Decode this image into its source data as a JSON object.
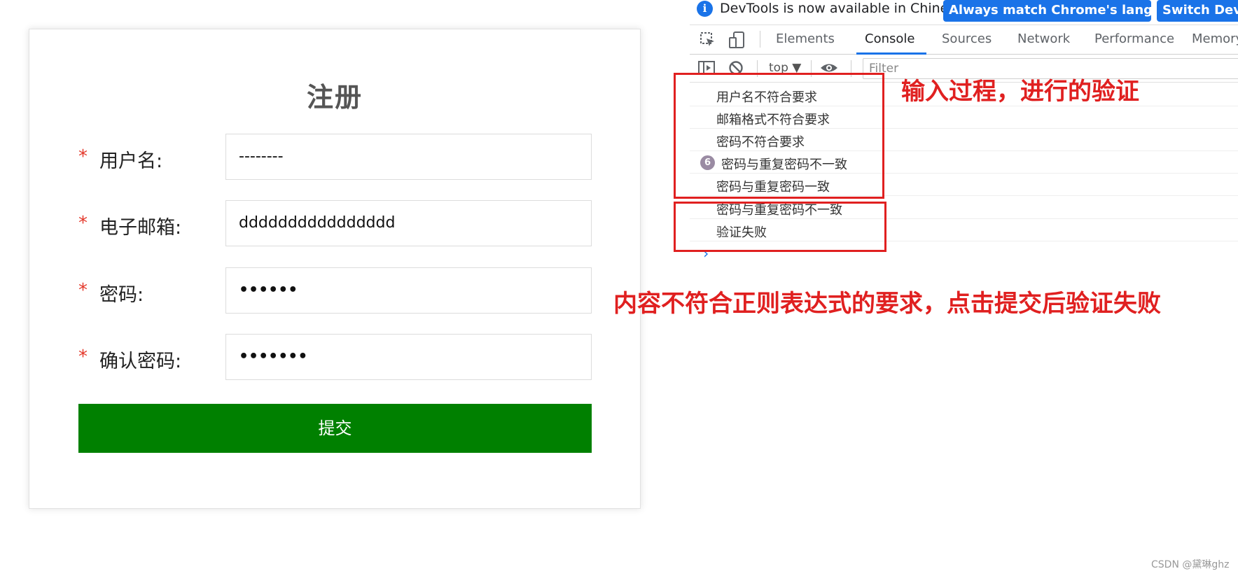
{
  "form": {
    "title": "注册",
    "required_mark": "*",
    "fields": [
      {
        "label": "用户名:",
        "value": "--------"
      },
      {
        "label": "电子邮箱:",
        "value": "dddddddddddddddd"
      },
      {
        "label": "密码:",
        "value": "••••••"
      },
      {
        "label": "确认密码:",
        "value": "•••••••"
      }
    ],
    "submit_label": "提交",
    "submit_color": "#008000"
  },
  "devtools": {
    "infobar": {
      "message": "DevTools is now available in Chinese!",
      "match_button": "Always match Chrome's language",
      "switch_button": "Switch DevTools to Chinese"
    },
    "tabs": [
      "Elements",
      "Console",
      "Sources",
      "Network",
      "Performance",
      "Memory"
    ],
    "active_tab": "Console",
    "context": "top ▼",
    "filter_placeholder": "Filter",
    "console_messages": [
      {
        "text": "用户名不符合要求"
      },
      {
        "text": "邮箱格式不符合要求"
      },
      {
        "text": "密码不符合要求"
      },
      {
        "text": "密码与重复密码不一致",
        "count": "6"
      },
      {
        "text": "密码与重复密码一致"
      },
      {
        "text": "密码与重复密码不一致"
      },
      {
        "text": "验证失败"
      }
    ],
    "prompt": "›"
  },
  "annotations": {
    "input_note": "输入过程，进行的验证",
    "submit_note": "内容不符合正则表达式的要求，点击提交后验证失败",
    "color": "#e02020"
  },
  "watermark": "CSDN @黛琳ghz",
  "icons": [
    "info-icon",
    "inspect-element-icon",
    "device-toolbar-icon",
    "sidebar-toggle-icon",
    "clear-console-icon",
    "eye-icon"
  ]
}
